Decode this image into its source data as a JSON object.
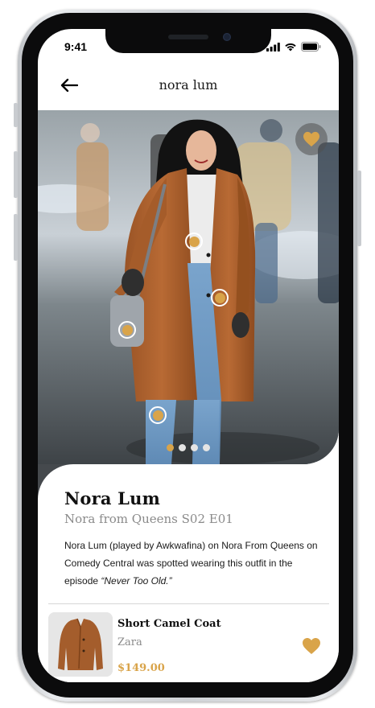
{
  "status_bar": {
    "time": "9:41"
  },
  "header": {
    "title": "nora lum"
  },
  "icons": {
    "back": "arrow-left-icon",
    "favorite": "heart-icon",
    "signal": "cellular-signal-icon",
    "wifi": "wifi-icon",
    "battery": "battery-icon"
  },
  "colors": {
    "accent": "#d9a44a",
    "hotspot_fill": "#d9a44a",
    "text_primary": "#111111",
    "text_secondary": "#8a8a8a",
    "dot_inactive": "#e4e4e4"
  },
  "carousel": {
    "total_pages": 4,
    "active_index": 0
  },
  "hotspots_count": 4,
  "profile": {
    "name": "Nora Lum",
    "episode": "Nora from Queens S02 E01",
    "description_prefix": "Nora Lum (played by Awkwafina) on Nora From Queens on Comedy Central was spotted wearing this outfit in the episode ",
    "description_episode_quote": "“Never Too Old.”"
  },
  "product": {
    "name": "Short Camel Coat",
    "brand": "Zara",
    "price": "$149.00"
  }
}
